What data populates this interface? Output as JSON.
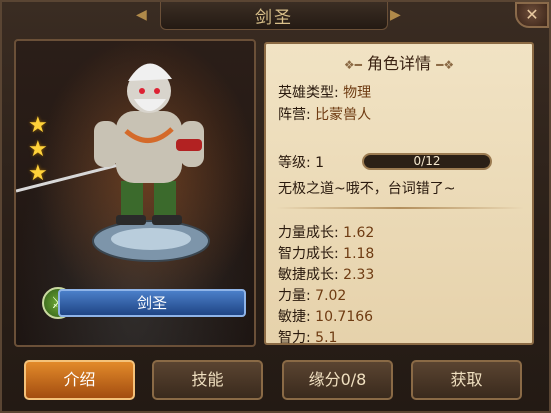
{
  "title": "剑圣",
  "close_glyph": "✕",
  "hero": {
    "name": "剑圣",
    "stars": 3,
    "class_icon": "crossed-swords-icon"
  },
  "details": {
    "header": "角色详情",
    "type_label": "英雄类型:",
    "type_value": "物理",
    "faction_label": "阵营:",
    "faction_value": "比蒙兽人",
    "level_label": "等级:",
    "level_value": "1",
    "exp_text": "0/12",
    "exp_fraction": 0,
    "quote": "无极之道~哦不，台词错了~",
    "stats": [
      {
        "label": "力量成长:",
        "value": "1.62"
      },
      {
        "label": "智力成长:",
        "value": "1.18"
      },
      {
        "label": "敏捷成长:",
        "value": "2.33"
      },
      {
        "label": "力量:",
        "value": "7.02"
      },
      {
        "label": "敏捷:",
        "value": "10.7166"
      },
      {
        "label": "智力:",
        "value": "5.1"
      }
    ]
  },
  "tabs": [
    {
      "label": "介绍",
      "active": true
    },
    {
      "label": "技能",
      "active": false
    },
    {
      "label": "缘分0/8",
      "active": false
    },
    {
      "label": "获取",
      "active": false
    }
  ],
  "colors": {
    "accent": "#e28a2a",
    "panel": "#f1e3c4",
    "name_bar": "#4b7fc9"
  }
}
